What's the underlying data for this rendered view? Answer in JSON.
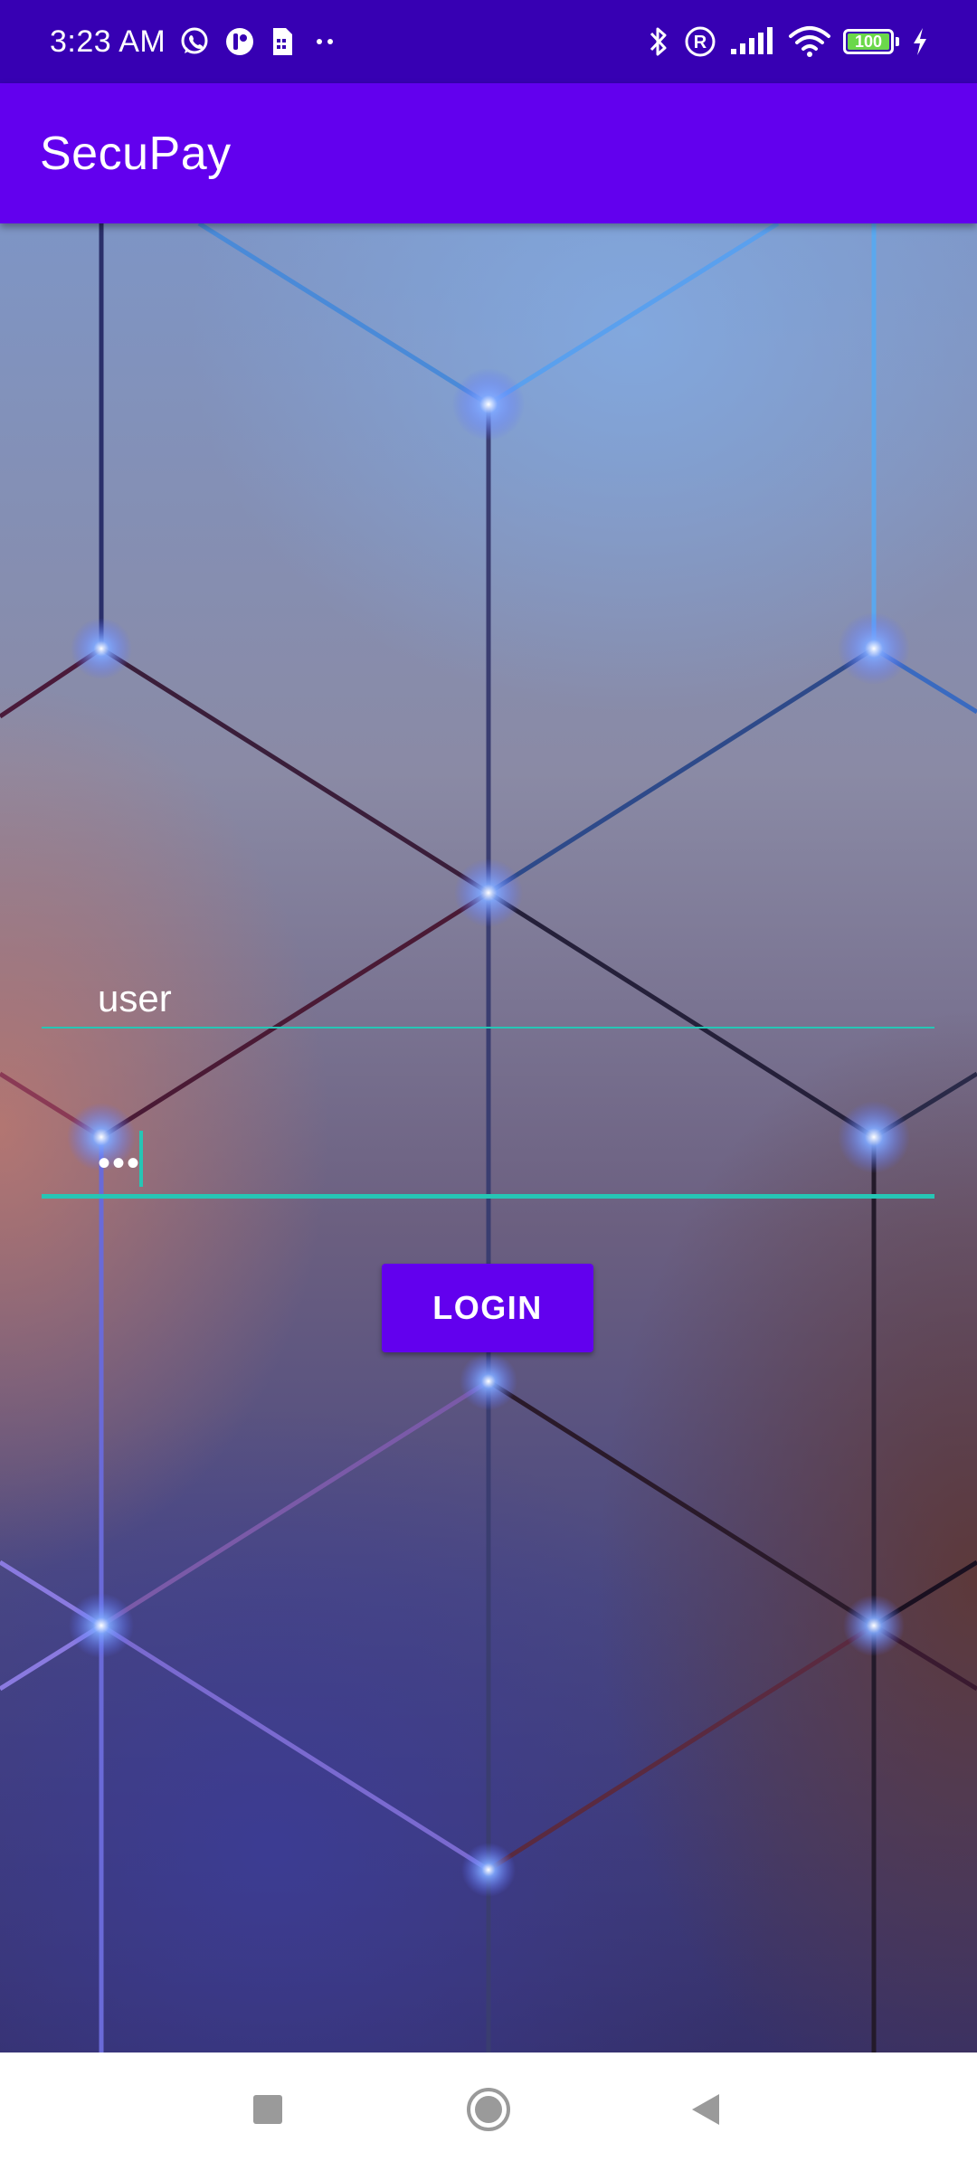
{
  "status_bar": {
    "time": "3:23 AM",
    "icons_left": [
      "whatsapp-icon",
      "app-notification-icon",
      "sim-card-icon",
      "more-dots-icon"
    ],
    "icons_right": [
      "bluetooth-icon",
      "roaming-r-icon",
      "signal-icon",
      "wifi-icon",
      "battery-icon",
      "charging-icon"
    ],
    "battery_level": "100"
  },
  "app_bar": {
    "title": "SecuPay",
    "color": "#6200ee",
    "status_color": "#3700b3"
  },
  "login_form": {
    "username": {
      "value": "user",
      "accent_color": "#26c6b5"
    },
    "password": {
      "value": "•••",
      "focused": true,
      "accent_color": "#26c6b5"
    },
    "login_button": {
      "label": "LOGIN"
    }
  },
  "navigation_bar": {
    "buttons": [
      "recents-square-icon",
      "home-circle-icon",
      "back-triangle-icon"
    ]
  }
}
